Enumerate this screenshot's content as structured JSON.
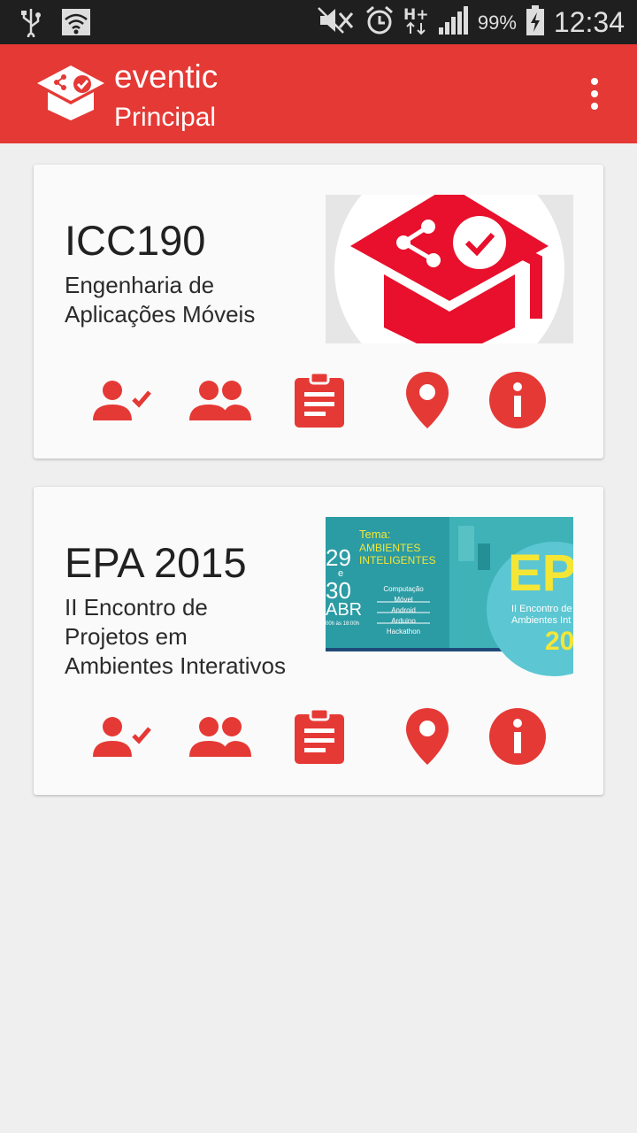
{
  "status_bar": {
    "battery": "99%",
    "time": "12:34"
  },
  "app_bar": {
    "app_name": "eventic",
    "screen_title": "Principal"
  },
  "cards": [
    {
      "title": "ICC190",
      "subtitle_line1": "Engenharia de",
      "subtitle_line2": "Aplicações Móveis",
      "actions": [
        "person-check-icon",
        "group-icon",
        "assignment-icon",
        "place-icon",
        "info-icon"
      ]
    },
    {
      "title": "EPA 2015",
      "subtitle_line1": "II Encontro de",
      "subtitle_line2": "Projetos em",
      "subtitle_line3": "Ambientes Interativos",
      "banner": {
        "tema": "Tema:",
        "theme_line1": "AMBIENTES",
        "theme_line2": "INTELIGENTES",
        "day1": "29",
        "connector": "e",
        "day2": "30",
        "month": "ABR",
        "hours": "00h às 18:00h",
        "topics": [
          "Computação Móvel",
          "Android",
          "Arduino",
          "Hackathon"
        ],
        "logo_text": "EPA",
        "event_line1": "II Encontro de",
        "event_line2": "Ambientes Int",
        "year_fragment": "20"
      },
      "actions": [
        "person-check-icon",
        "group-icon",
        "assignment-icon",
        "place-icon",
        "info-icon"
      ]
    }
  ],
  "colors": {
    "primary": "#e53935",
    "icon_red": "#e53935",
    "statusbar": "#1f1f1f",
    "background": "#efefef",
    "card": "#fafafa"
  }
}
